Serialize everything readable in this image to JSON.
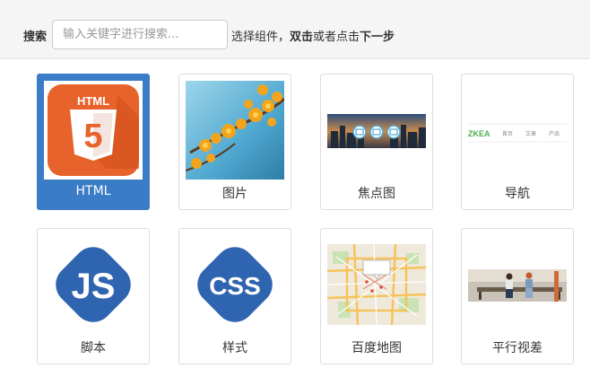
{
  "toolbar": {
    "search_label": "搜索",
    "search_placeholder": "输入关键字进行搜索...",
    "hint_prefix": "选择组件，",
    "hint_double_click": "双击",
    "hint_or_click": "或者点击",
    "hint_next": "下一步"
  },
  "components": [
    {
      "label": "HTML",
      "icon": "html5-icon",
      "selected": true
    },
    {
      "label": "图片",
      "icon": "photo-thumbnail"
    },
    {
      "label": "焦点图",
      "icon": "carousel-thumbnail"
    },
    {
      "label": "导航",
      "icon": "navbar-thumbnail"
    },
    {
      "label": "脚本",
      "icon": "js-icon"
    },
    {
      "label": "样式",
      "icon": "css-icon"
    },
    {
      "label": "百度地图",
      "icon": "map-thumbnail"
    },
    {
      "label": "平行视差",
      "icon": "parallax-thumbnail"
    }
  ],
  "html_badge": {
    "title": "HTML",
    "digit": "5"
  },
  "nav_preview": {
    "logo": "ZKEA",
    "links": [
      "首页",
      "文章",
      "产品"
    ]
  },
  "js_badge": "JS",
  "css_badge": "CSS",
  "colors": {
    "accent": "#3a7cc6",
    "html5_orange": "#e8622b",
    "badge_blue": "#2f64b0"
  }
}
